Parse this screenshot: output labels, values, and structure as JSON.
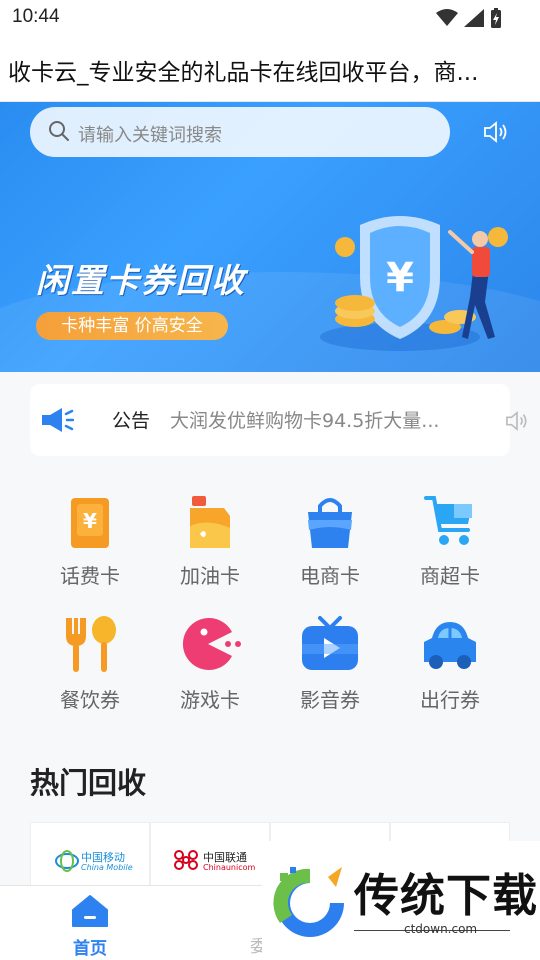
{
  "status_bar": {
    "time": "10:44"
  },
  "title_bar": {
    "title": "收卡云_专业安全的礼品卡在线回收平台，商..."
  },
  "banner": {
    "search_placeholder": "请输入关键词搜索",
    "headline": "闲置卡券回收",
    "pill": "卡种丰富 价高安全",
    "currency_symbol": "¥"
  },
  "notice": {
    "label": "公告",
    "text": "大润发优鲜购物卡94.5折大量..."
  },
  "categories": [
    {
      "label": "话费卡",
      "icon": "phone-bill-card-icon",
      "color": "#f59a23"
    },
    {
      "label": "加油卡",
      "icon": "fuel-card-icon",
      "color": "#f7a52b"
    },
    {
      "label": "电商卡",
      "icon": "shopping-bag-icon",
      "color": "#2d82f0"
    },
    {
      "label": "商超卡",
      "icon": "shopping-cart-icon",
      "color": "#2aa6f5"
    },
    {
      "label": "餐饮券",
      "icon": "dining-icon",
      "color": "#f5a623"
    },
    {
      "label": "游戏卡",
      "icon": "game-pacman-icon",
      "color": "#ee3d72"
    },
    {
      "label": "影音券",
      "icon": "tv-icon",
      "color": "#2d7ff0"
    },
    {
      "label": "出行券",
      "icon": "car-icon",
      "color": "#2a86ee"
    }
  ],
  "hot": {
    "title": "热门回收",
    "cards": [
      {
        "name_cn": "中国移动",
        "name_en": "China Mobile",
        "color": "#1a8fd8"
      },
      {
        "name_cn": "中国联通",
        "name_en": "Chinaunicom",
        "color": "#d9001b"
      },
      {
        "name_cn": "",
        "name_en": "",
        "color": "#999999"
      },
      {
        "name_cn": "",
        "name_en": "",
        "color": "#999999"
      }
    ]
  },
  "tabbar": {
    "home_label": "首页",
    "second_label": "委"
  },
  "watermark": {
    "text": "传统下载",
    "url": "ctdown.com"
  },
  "colors": {
    "accent": "#2d82f0",
    "banner": "#2f92f5",
    "orange": "#f5a03a"
  }
}
